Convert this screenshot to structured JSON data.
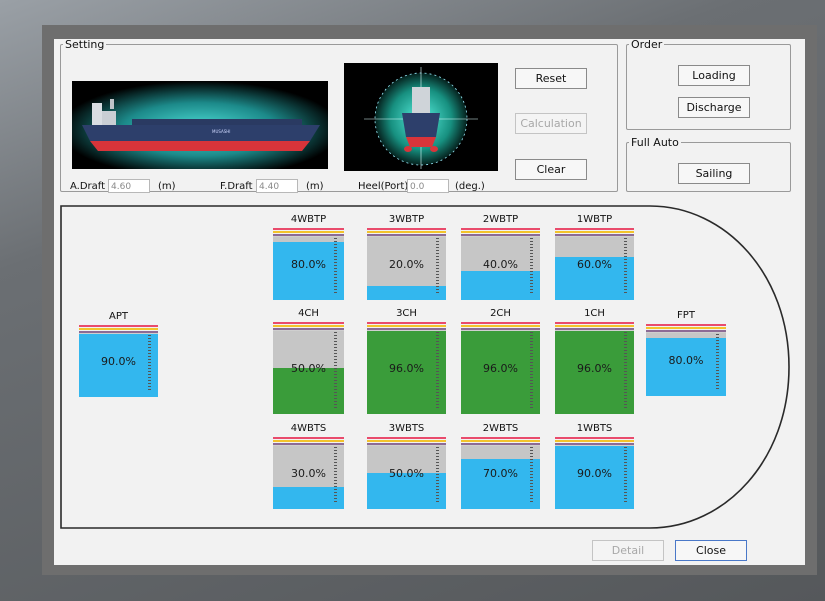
{
  "setting": {
    "legend": "Setting",
    "aft_draft_label": "A.Draft",
    "aft_draft_value": "4.60",
    "aft_draft_unit": "(m)",
    "fore_draft_label": "F.Draft",
    "fore_draft_value": "4.40",
    "fore_draft_unit": "(m)",
    "heel_label": "Heel(Port)",
    "heel_value": "0.0",
    "heel_unit": "(deg.)",
    "ship_name": "MUSASHI"
  },
  "buttons": {
    "reset": "Reset",
    "calculation": "Calculation",
    "clear": "Clear",
    "loading": "Loading",
    "discharge": "Discharge",
    "sailing": "Sailing",
    "detail": "Detail",
    "close": "Close"
  },
  "order": {
    "legend": "Order"
  },
  "full_auto": {
    "legend": "Full Auto"
  },
  "tanks": {
    "wbtp4": {
      "name": "4WBTP",
      "pct": "80.0%",
      "level": 80,
      "kind": "water"
    },
    "wbtp3": {
      "name": "3WBTP",
      "pct": "20.0%",
      "level": 20,
      "kind": "water"
    },
    "wbtp2": {
      "name": "2WBTP",
      "pct": "40.0%",
      "level": 40,
      "kind": "water"
    },
    "wbtp1": {
      "name": "1WBTP",
      "pct": "60.0%",
      "level": 60,
      "kind": "water"
    },
    "apt": {
      "name": "APT",
      "pct": "90.0%",
      "level": 90,
      "kind": "water"
    },
    "ch4": {
      "name": "4CH",
      "pct": "50.0%",
      "level": 50,
      "kind": "cargo"
    },
    "ch3": {
      "name": "3CH",
      "pct": "96.0%",
      "level": 96,
      "kind": "cargo"
    },
    "ch2": {
      "name": "2CH",
      "pct": "96.0%",
      "level": 96,
      "kind": "cargo"
    },
    "ch1": {
      "name": "1CH",
      "pct": "96.0%",
      "level": 96,
      "kind": "cargo"
    },
    "fpt": {
      "name": "FPT",
      "pct": "80.0%",
      "level": 80,
      "kind": "water"
    },
    "wbts4": {
      "name": "4WBTS",
      "pct": "30.0%",
      "level": 30,
      "kind": "water"
    },
    "wbts3": {
      "name": "3WBTS",
      "pct": "50.0%",
      "level": 50,
      "kind": "water"
    },
    "wbts2": {
      "name": "2WBTS",
      "pct": "70.0%",
      "level": 70,
      "kind": "water"
    },
    "wbts1": {
      "name": "1WBTS",
      "pct": "90.0%",
      "level": 90,
      "kind": "water"
    }
  },
  "colors": {
    "water": "#33b7ee",
    "cargo": "#3a9c3a",
    "empty": "#c6c6c6"
  }
}
